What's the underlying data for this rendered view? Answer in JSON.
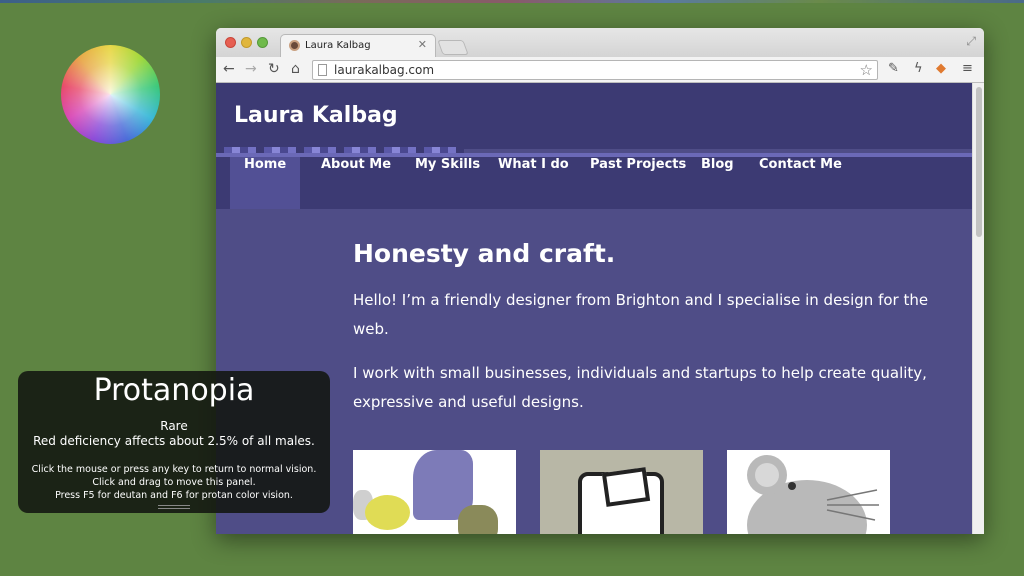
{
  "browser": {
    "tab_title": "Laura Kalbag",
    "url": "laurakalbag.com"
  },
  "site": {
    "title": "Laura Kalbag",
    "nav": [
      "Home",
      "About Me",
      "My Skills",
      "What I do",
      "Past Projects",
      "Blog",
      "Contact Me"
    ],
    "active_nav": "Home",
    "headline": "Honesty and craft.",
    "paragraphs": [
      "Hello! I’m a friendly designer from Brighton and I specialise in design for the web.",
      "I work with small businesses, individuals and startups to help create quality, expressive and useful designs."
    ]
  },
  "simulator": {
    "title": "Protanopia",
    "rarity": "Rare",
    "description": "Red deficiency affects about 2.5% of all males.",
    "help": [
      "Click the mouse or press any key to return to normal vision.",
      "Click and drag to move this panel.",
      "Press  F5 for deutan and F6 for protan color vision."
    ]
  },
  "colors": {
    "desktop": "#5e8442",
    "site_background": "#4f4d87",
    "site_header": "#3c3a73",
    "nav_active": "#525095"
  }
}
